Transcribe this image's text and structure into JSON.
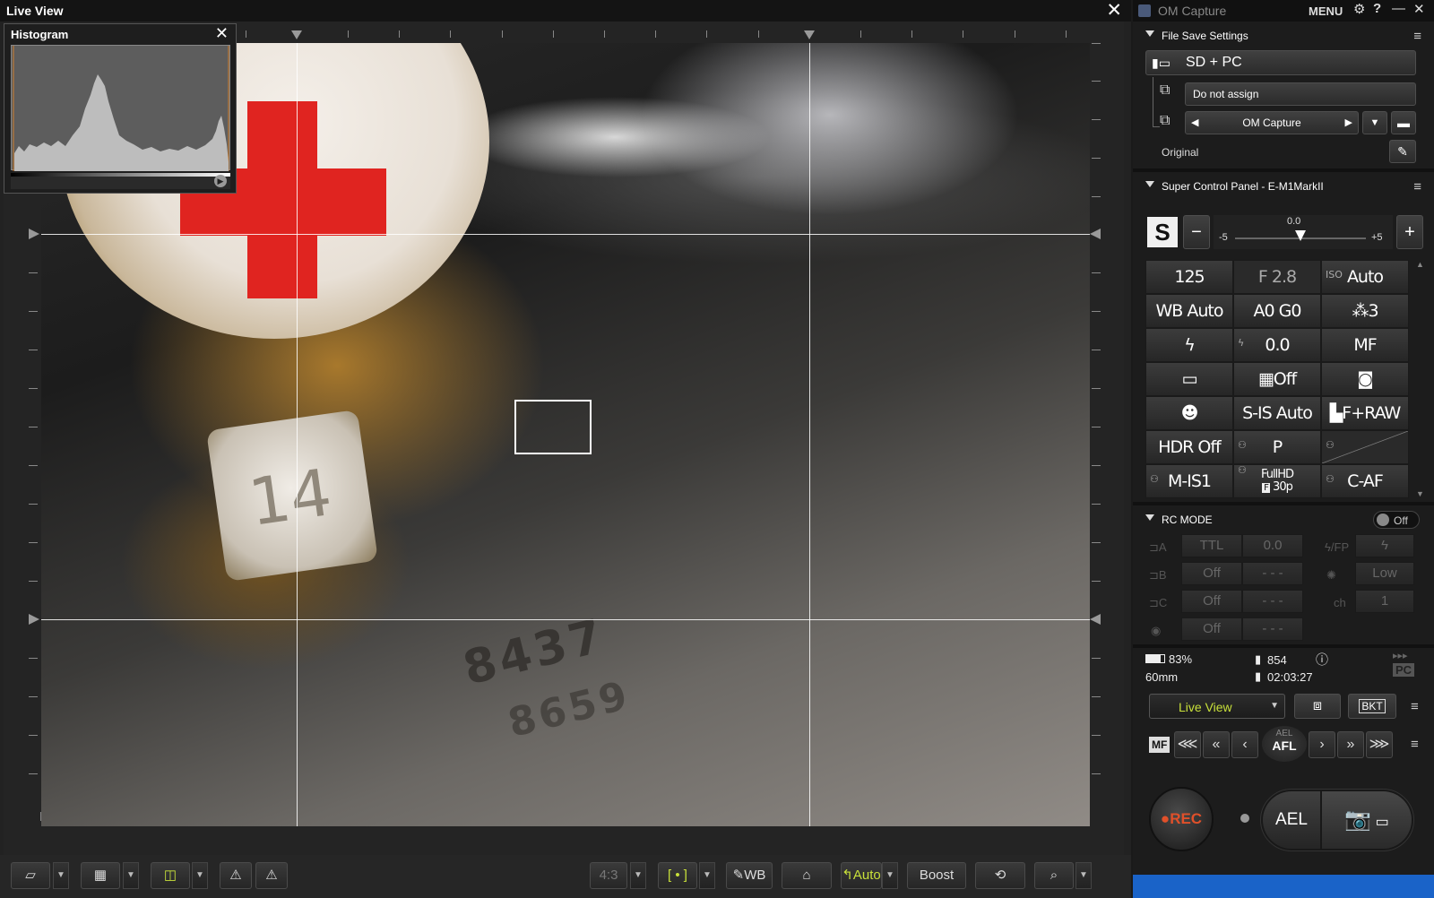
{
  "live_view": {
    "title": "Live View",
    "histogram": {
      "title": "Histogram"
    },
    "toolbar": {
      "aspect": "4:3",
      "wb": "WB",
      "auto": "Auto",
      "boost": "Boost"
    }
  },
  "photo": {
    "tag_number": "14",
    "digits_row1": "8437",
    "digits_row2": "8659"
  },
  "om_capture": {
    "title": "OM Capture",
    "menu": "MENU",
    "file_save": {
      "section": "File Save Settings",
      "destination": "SD + PC",
      "assign": "Do not assign",
      "folder": "OM Capture",
      "format": "Original"
    },
    "super_control": {
      "section": "Super Control Panel - E-M1MarkII",
      "mode": "S",
      "exposure_comp": "0.0",
      "exposure_min": "-5",
      "exposure_max": "+5",
      "exposure_value": 0.5,
      "grid": [
        [
          "125",
          "F 2.8",
          "Auto"
        ],
        [
          "WB Auto",
          "A0 G0",
          "3"
        ],
        [
          "",
          "0.0",
          "MF"
        ],
        [
          "",
          "Off",
          ""
        ],
        [
          "",
          "S-IS Auto",
          "F+RAW"
        ],
        [
          "HDR Off",
          "P",
          ""
        ],
        [
          "M-IS1",
          "FullHD",
          "C-AF"
        ]
      ],
      "iso_label": "ISO",
      "movie_fps": "30p",
      "movie_tag": "F"
    },
    "rc_mode": {
      "section": "RC MODE",
      "toggle": "Off",
      "rows": [
        {
          "label": "A",
          "mode": "TTL",
          "value": "0.0"
        },
        {
          "label": "B",
          "mode": "Off",
          "value": "- - -"
        },
        {
          "label": "C",
          "mode": "Off",
          "value": "- - -"
        },
        {
          "label": "",
          "mode": "Off",
          "value": "- - -"
        }
      ],
      "right": [
        {
          "label": "FP",
          "value": ""
        },
        {
          "label": "",
          "value": "Low"
        },
        {
          "label": "ch",
          "value": "1"
        }
      ]
    },
    "status": {
      "battery": "83%",
      "focal": "60mm",
      "shots": "854",
      "time": "02:03:27",
      "pc": "PC"
    },
    "controls": {
      "view_select": "Live View",
      "bkt": "BKT",
      "mf": "MF",
      "ael_small": "AEL",
      "afl": "AFL",
      "rec": "REC",
      "ael": "AEL"
    }
  },
  "colors": {
    "accent_green": "#c8e03a",
    "rec_orange": "#e0502a",
    "cross_red": "#e02420"
  }
}
